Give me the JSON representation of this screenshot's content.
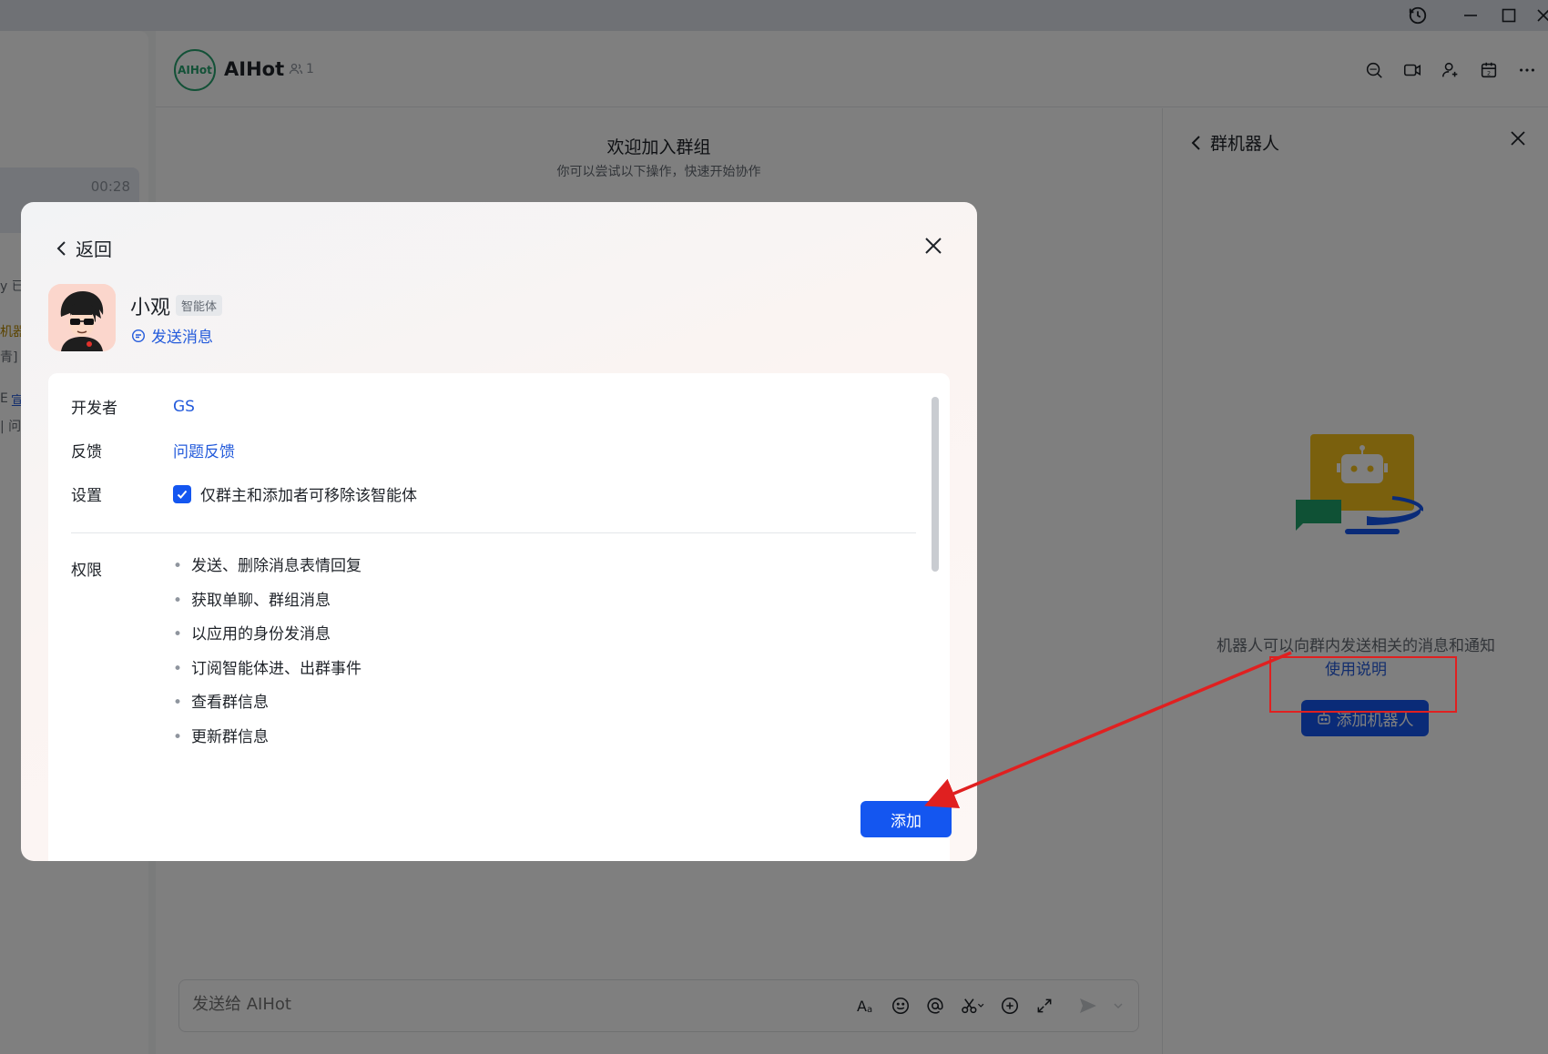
{
  "sidebar": {
    "chat_time": "00:28",
    "fragments": [
      "y 已",
      "机器",
      "青]",
      "E",
      "宣",
      "| 问"
    ]
  },
  "header": {
    "group_avatar_text": "AIHot",
    "group_name": "AIHot",
    "member_count": "1"
  },
  "chat": {
    "welcome_title": "欢迎加入群组",
    "welcome_subtitle": "你可以尝试以下操作，快速开始协作",
    "composer_placeholder": "发送给 AIHot"
  },
  "right_panel": {
    "title": "群机器人",
    "description": "机器人可以向群内发送相关的消息和通知",
    "help_link": "使用说明",
    "add_button": "添加机器人"
  },
  "modal": {
    "back_label": "返回",
    "bot_name": "小观",
    "bot_badge": "智能体",
    "send_message": "发送消息",
    "developer_label": "开发者",
    "developer_value": "GS",
    "feedback_label": "反馈",
    "feedback_value": "问题反馈",
    "settings_label": "设置",
    "settings_value": "仅群主和添加者可移除该智能体",
    "settings_checked": true,
    "permissions_label": "权限",
    "permissions": [
      "发送、删除消息表情回复",
      "获取单聊、群组消息",
      "以应用的身份发消息",
      "订阅智能体进、出群事件",
      "查看群信息",
      "更新群信息"
    ],
    "add_button": "添加"
  },
  "colors": {
    "primary": "#1456f0",
    "link": "#245bdb",
    "annotation": "#e02020",
    "group_avatar": "#27a36f"
  }
}
